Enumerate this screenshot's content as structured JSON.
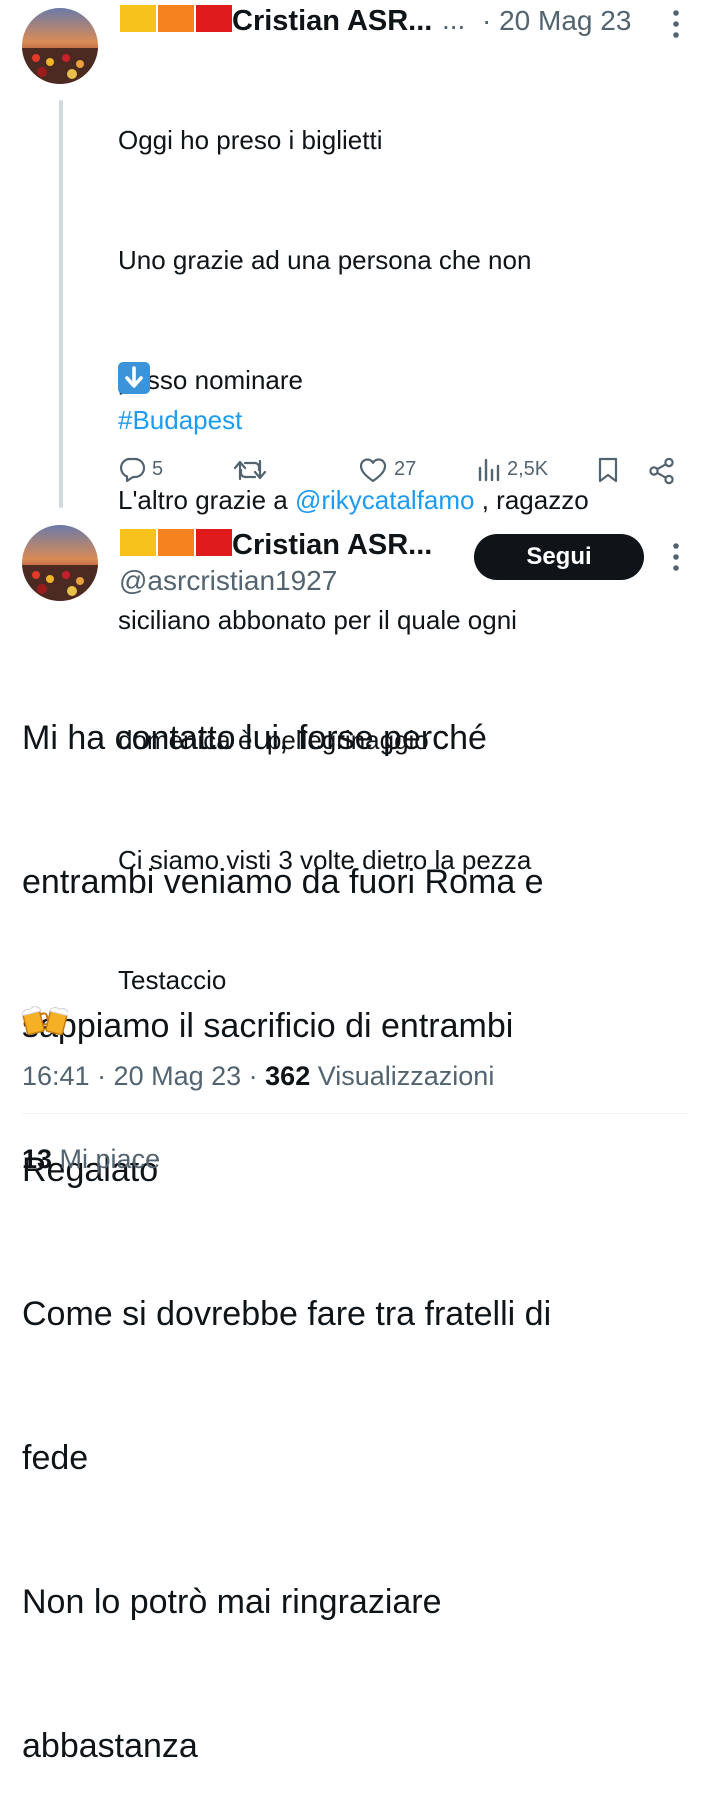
{
  "tweet1": {
    "author_name": "Cristian ASR...",
    "more_ellipsis": "...",
    "date": "· 20 Mag 23",
    "text_lines": [
      "Oggi ho preso i biglietti",
      "Uno grazie ad una persona che non",
      "posso nominare",
      "L'altro grazie a ",
      "siciliano abbonato per il quale ogni",
      "domenica è  pellegrinaggio",
      "Ci siamo visti 3 volte dietro la pezza",
      "Testaccio"
    ],
    "mention": "@rikycatalfamo",
    "mention_suffix": " , ragazzo",
    "arrow_emoji": "⬇️",
    "hashtag": "#Budapest",
    "replies": "5",
    "likes": "27",
    "views": "2,5K"
  },
  "tweet2": {
    "author_name": "Cristian ASR...",
    "handle": "@asrcristian1927",
    "follow_label": "Segui",
    "text_lines": [
      "Mi ha contatto lui, forse perché",
      "entrambi veniamo da fuori Roma e",
      "sappiamo il sacrificio di entrambi",
      "Regalato",
      "Come si dovrebbe fare tra fratelli di",
      "fede",
      "Non lo potrò mai ringraziare",
      "abbastanza"
    ],
    "time": "16:41 · 20 Mag 23 · ",
    "views_count": "362",
    "views_label": " Visualizzazioni"
  },
  "likes_summary": {
    "count": "13",
    "label": " Mi piace"
  },
  "colors": {
    "link": "#1d9bf0",
    "flag_yellow": "#f7c21b",
    "flag_orange": "#f5821f",
    "flag_red": "#e01b1b"
  },
  "icons": [
    "reply-icon",
    "retweet-icon",
    "like-icon",
    "views-icon",
    "bookmark-icon",
    "share-icon",
    "more-icon",
    "beer-mugs-icon"
  ]
}
